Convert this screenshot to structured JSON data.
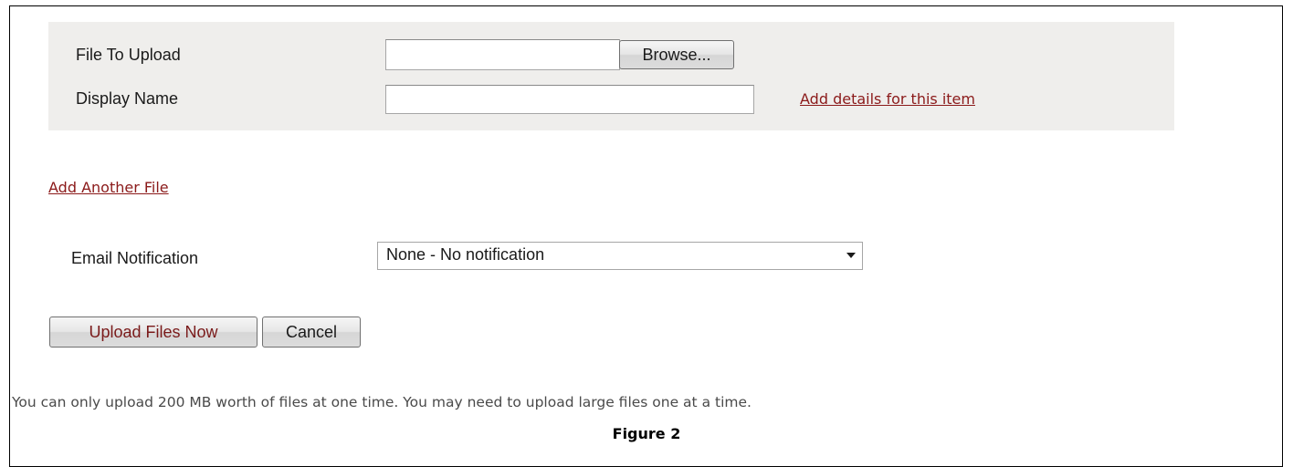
{
  "upload_form": {
    "file_to_upload": {
      "label": "File To Upload",
      "value": "",
      "browse_label": "Browse..."
    },
    "display_name": {
      "label": "Display Name",
      "value": "",
      "details_link": "Add details for this item"
    },
    "add_another_file_link": "Add Another File",
    "email_notification": {
      "label": "Email Notification",
      "selected": "None - No notification"
    },
    "buttons": {
      "upload_label": "Upload Files Now",
      "cancel_label": "Cancel"
    },
    "limit_note": "You can only upload 200 MB worth of files at one time. You may need to upload large files one at a time."
  },
  "caption": "Figure 2",
  "colors": {
    "panel_background": "#efeeec",
    "link": "#8b1a1a",
    "primary_button_text": "#7a1a1a"
  }
}
